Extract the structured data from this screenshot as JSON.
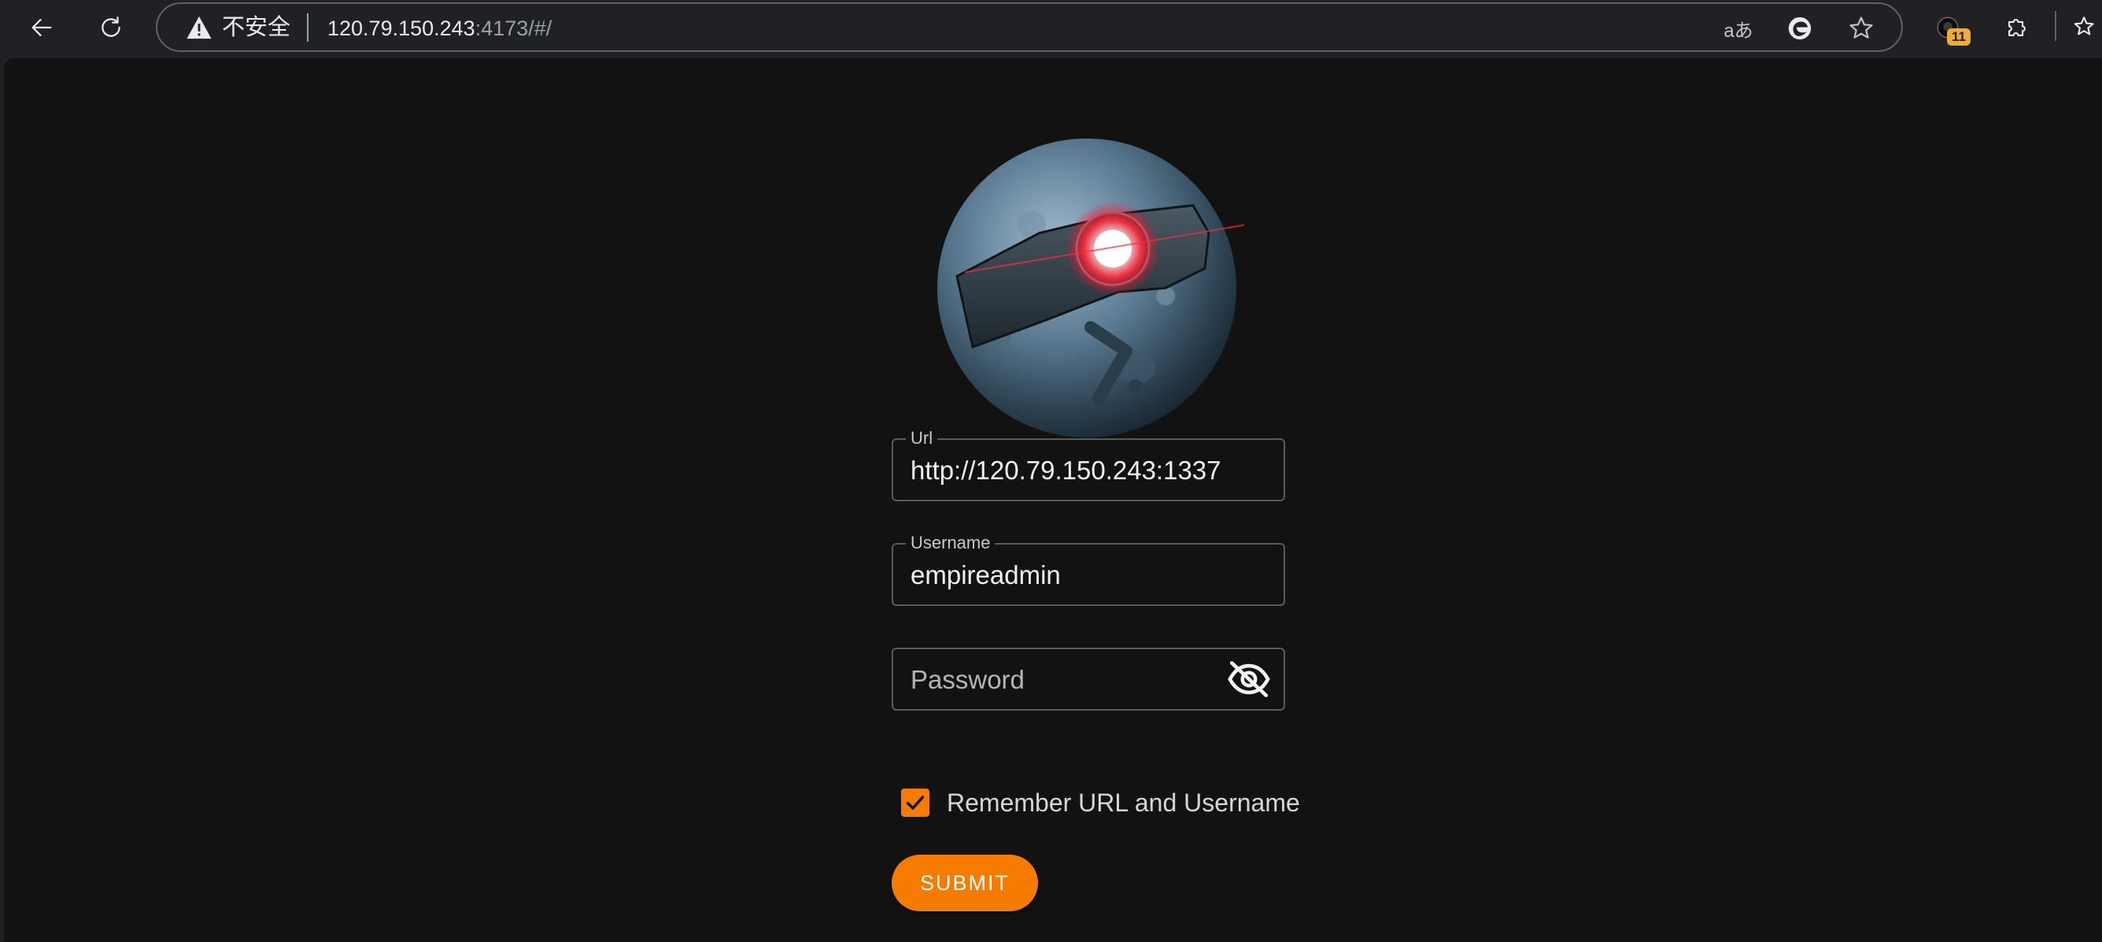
{
  "browser": {
    "security_label": "不安全",
    "url_host": "120.79.150.243",
    "url_rest": ":4173/#/",
    "read_aloud_glyph": "aあ",
    "extension_badge": "11",
    "icons": [
      "back-icon",
      "reload-icon",
      "warning-icon",
      "read-aloud-icon",
      "edge-icon",
      "favorite-star-icon",
      "extension-profile-icon",
      "extensions-puzzle-icon",
      "favorites-icon"
    ]
  },
  "login": {
    "url_label": "Url",
    "url_value": "http://120.79.150.243:1337",
    "username_label": "Username",
    "username_value": "empireadmin",
    "password_placeholder": "Password",
    "remember_label": "Remember URL and Username",
    "remember_checked": true,
    "submit_label": "SUBMIT"
  },
  "colors": {
    "accent": "#f57c00",
    "page_bg": "#121212",
    "chrome_bg": "#202124"
  }
}
